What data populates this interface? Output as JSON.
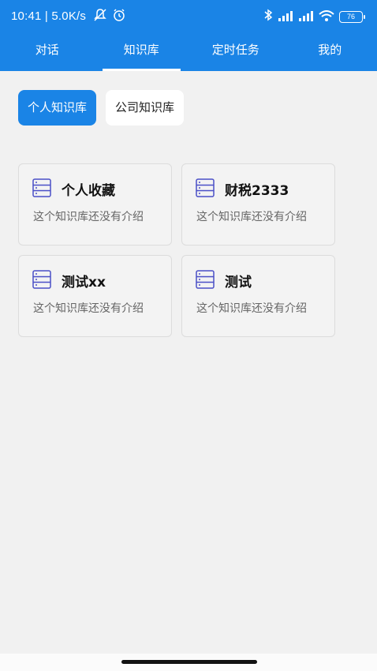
{
  "status_bar": {
    "time": "10:41 | 5.0K/s",
    "battery": "76"
  },
  "tabs": [
    {
      "label": "对话"
    },
    {
      "label": "知识库"
    },
    {
      "label": "定时任务"
    },
    {
      "label": "我的"
    }
  ],
  "active_tab": "知识库",
  "segments": [
    {
      "label": "个人知识库"
    },
    {
      "label": "公司知识库"
    }
  ],
  "active_segment": "个人知识库",
  "cards": [
    {
      "title": "个人收藏",
      "description": "这个知识库还没有介绍",
      "icon": "database-icon"
    },
    {
      "title": "财税2333",
      "description": "这个知识库还没有介绍",
      "icon": "database-icon"
    },
    {
      "title": "测试xx",
      "description": "这个知识库还没有介绍",
      "icon": "database-icon"
    },
    {
      "title": "测试",
      "description": "这个知识库还没有介绍",
      "icon": "database-icon"
    }
  ],
  "colors": {
    "accent": "#1a84e6",
    "background": "#f1f1f1",
    "card_border": "#dcdcdc",
    "icon_color": "#4b4fc7"
  }
}
